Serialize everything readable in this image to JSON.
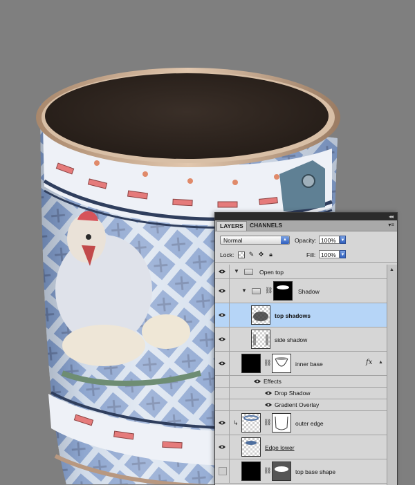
{
  "panel": {
    "tabs": [
      {
        "label": "LAYERS",
        "active": true
      },
      {
        "label": "CHANNELS",
        "active": false
      }
    ],
    "collapse_glyph": "◂◂",
    "menu_glyph": "▾≡",
    "blend_mode": "Normal",
    "opacity_label": "Opacity:",
    "opacity_value": "100%",
    "lock_label": "Lock:",
    "fill_label": "Fill:",
    "fill_value": "100%"
  },
  "layers": [
    {
      "name": "Open top",
      "kind": "group",
      "visible": true,
      "expanded": true
    },
    {
      "name": "Shadow",
      "kind": "group",
      "visible": true,
      "expanded": true,
      "has_mask": true
    },
    {
      "name": "top shadows",
      "kind": "layer",
      "visible": true,
      "selected": true
    },
    {
      "name": "side shadow",
      "kind": "layer",
      "visible": true
    },
    {
      "name": "inner base",
      "kind": "layer",
      "visible": true,
      "has_mask": true,
      "fx_label": "fx"
    },
    {
      "name": "Effects",
      "kind": "effect-header",
      "visible": true
    },
    {
      "name": "Drop Shadow",
      "kind": "effect",
      "visible": true
    },
    {
      "name": "Gradient Overlay",
      "kind": "effect",
      "visible": true
    },
    {
      "name": "outer edge",
      "kind": "layer",
      "visible": true,
      "clipped": true,
      "has_mask": true
    },
    {
      "name": "Edge lower",
      "kind": "layer",
      "visible": true
    },
    {
      "name": "top base shape",
      "kind": "layer",
      "visible": false,
      "has_mask": true
    }
  ],
  "colors": {
    "canvas_bg": "#7f7f7f",
    "panel_bg": "#d6d6d6",
    "selection": "#b6d5f7",
    "titlebar": "#2b2b2b"
  }
}
